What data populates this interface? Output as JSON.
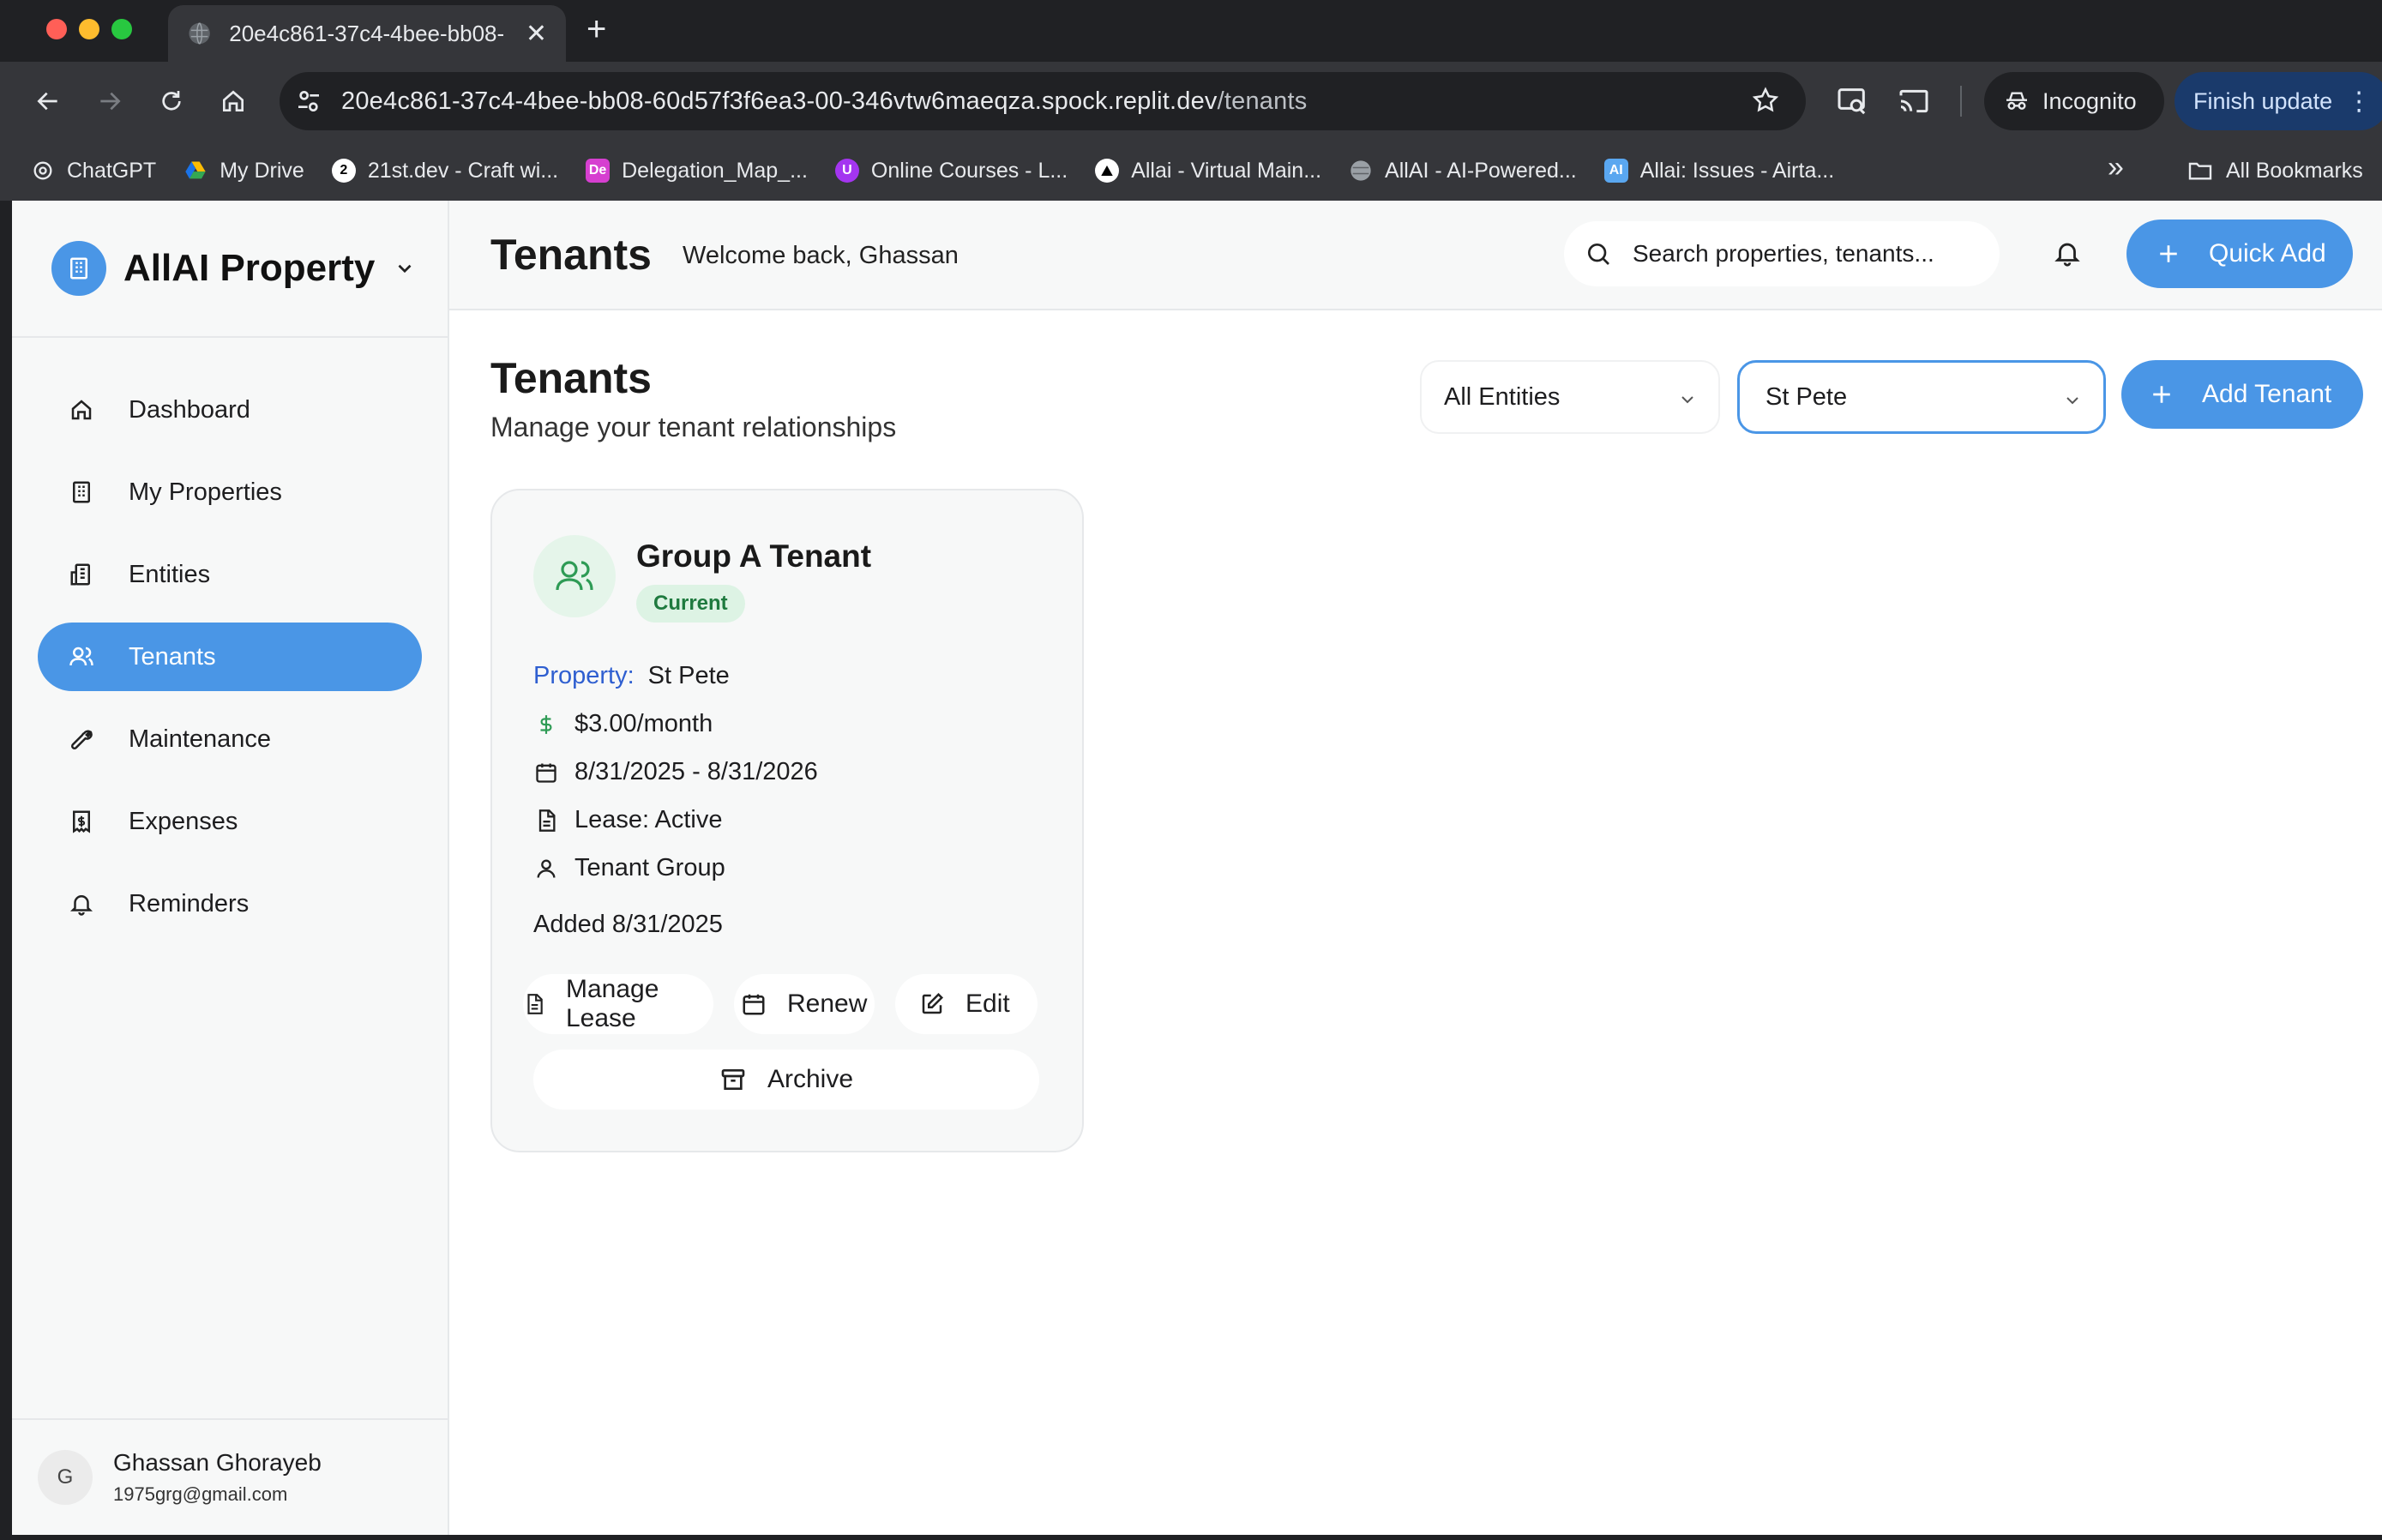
{
  "browser": {
    "tab_title": "20e4c861-37c4-4bee-bb08-",
    "url_host": "20e4c861-37c4-4bee-bb08-60d57f3f6ea3-00-346vtw6maeqza.spock.replit.dev",
    "url_path": "/tenants",
    "incognito_label": "Incognito",
    "finish_update_label": "Finish update",
    "bookmarks": [
      {
        "label": "ChatGPT",
        "icon": "openai-icon"
      },
      {
        "label": "My Drive",
        "icon": "google-drive-icon"
      },
      {
        "label": "21st.dev - Craft wi...",
        "icon": "21st-icon"
      },
      {
        "label": "Delegation_Map_...",
        "icon": "de-icon"
      },
      {
        "label": "Online Courses - L...",
        "icon": "udemy-icon"
      },
      {
        "label": "Allai - Virtual Main...",
        "icon": "triangle-icon"
      },
      {
        "label": "AllAI - AI-Powered...",
        "icon": "globe-icon"
      },
      {
        "label": "Allai: Issues - Airta...",
        "icon": "ai-icon"
      }
    ],
    "all_bookmarks_label": "All Bookmarks"
  },
  "sidebar": {
    "brand": "AllAI Property",
    "items": [
      {
        "label": "Dashboard",
        "icon": "home-icon",
        "active": false
      },
      {
        "label": "My Properties",
        "icon": "building-icon",
        "active": false
      },
      {
        "label": "Entities",
        "icon": "buildings-icon",
        "active": false
      },
      {
        "label": "Tenants",
        "icon": "users-icon",
        "active": true
      },
      {
        "label": "Maintenance",
        "icon": "wrench-icon",
        "active": false
      },
      {
        "label": "Expenses",
        "icon": "receipt-icon",
        "active": false
      },
      {
        "label": "Reminders",
        "icon": "bell-icon",
        "active": false
      }
    ],
    "user": {
      "initial": "G",
      "name": "Ghassan Ghorayeb",
      "email": "1975grg@gmail.com"
    }
  },
  "header": {
    "title": "Tenants",
    "welcome": "Welcome back, Ghassan",
    "search_placeholder": "Search properties, tenants...",
    "quick_add_label": "Quick Add"
  },
  "page": {
    "heading": "Tenants",
    "subtitle": "Manage your tenant relationships",
    "entity_filter": "All Entities",
    "property_filter": "St Pete",
    "add_tenant_label": "Add Tenant"
  },
  "tenant_card": {
    "name": "Group A Tenant",
    "status": "Current",
    "property_label": "Property:",
    "property": "St Pete",
    "rent": "$3.00/month",
    "lease_dates": "8/31/2025 - 8/31/2026",
    "lease_status": "Lease: Active",
    "tenant_type": "Tenant Group",
    "added": "Added 8/31/2025",
    "actions": {
      "manage_lease": "Manage Lease",
      "renew": "Renew",
      "edit": "Edit",
      "archive": "Archive"
    }
  },
  "colors": {
    "accent": "#4a96e6",
    "status_green_bg": "#ddf3e4",
    "status_green_text": "#1f7a3f",
    "property_label_blue": "#2f5fd0"
  }
}
